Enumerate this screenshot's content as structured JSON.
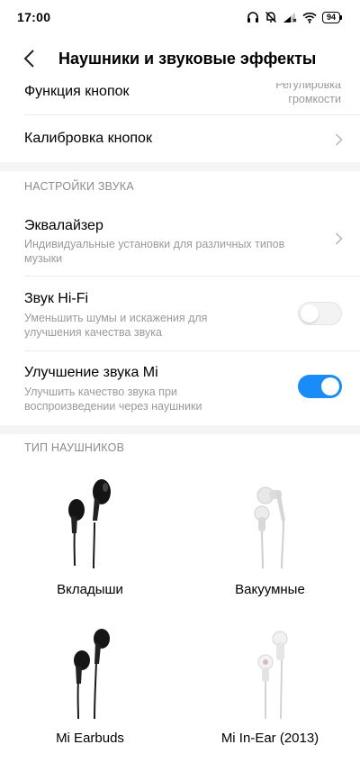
{
  "status_bar": {
    "time": "17:00",
    "battery": "94",
    "icons": [
      "headphones-icon",
      "mute-icon",
      "signal-icon",
      "wifi-icon",
      "battery-icon"
    ]
  },
  "header": {
    "title": "Наушники и звуковые эффекты",
    "back_icon": "chevron-left-icon"
  },
  "settings": {
    "button_function": {
      "label": "Функция кнопок",
      "value_line1": "Регулировка",
      "value_line2": "громкости"
    },
    "button_calibration": {
      "label": "Калибровка кнопок"
    },
    "sound_section_header": "НАСТРОЙКИ ЗВУКА",
    "equalizer": {
      "label": "Эквалайзер",
      "sub_line1": "Индивидуальные установки для различных типов",
      "sub_line2": "музыки"
    },
    "hifi": {
      "label": "Звук Hi-Fi",
      "sub_line1": "Уменьшить шумы и искажения для",
      "sub_line2": "улучшения качества звука",
      "enabled": false
    },
    "mi_enhance": {
      "label": "Улучшение звука Mi",
      "sub_line1": "Улучшить качество звука при",
      "sub_line2": "воспроизведении через наушники",
      "enabled": true
    },
    "headphone_type_header": "ТИП НАУШНИКОВ"
  },
  "headphones": [
    {
      "label": "Вкладыши",
      "color": "#111111",
      "style": "earbud"
    },
    {
      "label": "Вакуумные",
      "color": "#e6e6e6",
      "style": "in-ear"
    },
    {
      "label": "Mi Earbuds",
      "color": "#111111",
      "style": "earbud"
    },
    {
      "label": "Mi In-Ear (2013)",
      "color": "#f1f1f1",
      "style": "in-ear"
    }
  ],
  "colors": {
    "accent": "#1a8cf8",
    "secondary_text": "#9a9a9a",
    "band": "#f4f4f4"
  }
}
